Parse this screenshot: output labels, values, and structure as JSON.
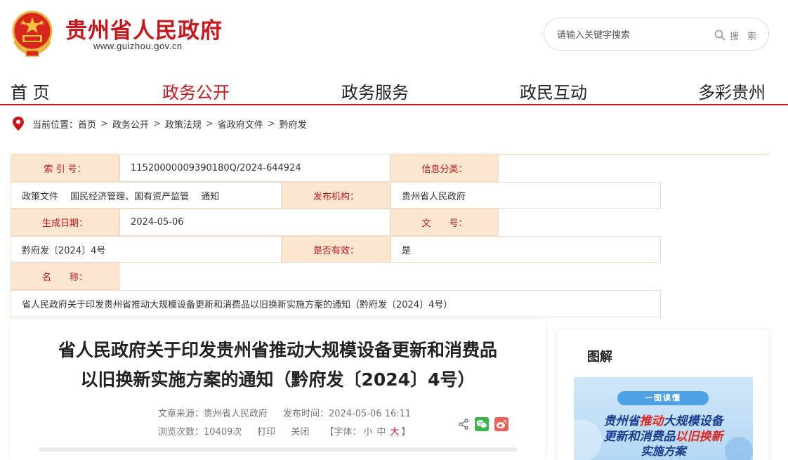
{
  "header": {
    "site_title": "贵州省人民政府",
    "site_url": "www.guizhou.gov.cn",
    "search": {
      "placeholder": "请输入关键字搜索",
      "button_label": "搜 索"
    }
  },
  "nav": {
    "items": [
      {
        "label": "首 页"
      },
      {
        "label": "政务公开"
      },
      {
        "label": "政务服务"
      },
      {
        "label": "政民互动"
      },
      {
        "label": "多彩贵州"
      }
    ],
    "active_index": 1
  },
  "breadcrumb": {
    "prefix": "当前位置：",
    "items": [
      "首页",
      "政务公开",
      "政策法规",
      "省政府文件",
      "黔府发"
    ],
    "separator": ">"
  },
  "info": {
    "index_label": "索 引 号：",
    "index_value": "11520000009390180Q/2024-644924",
    "category_label": "信息分类：",
    "category_value": "政策文件　 国民经济管理、国有资产监管　 通知",
    "publisher_label": "发布机构：",
    "publisher_value": "贵州省人民政府",
    "date_label": "生成日期：",
    "date_value": "2024-05-06",
    "docno_label": "文　　号：",
    "docno_value": "黔府发〔2024〕4号",
    "valid_label": "是否有效：",
    "valid_value": "是",
    "name_label": "名　　称：",
    "name_value": "省人民政府关于印发贵州省推动大规模设备更新和消费品以旧换新实施方案的通知（黔府发〔2024〕4号）"
  },
  "article": {
    "title_line1": "省人民政府关于印发贵州省推动大规模设备更新和消费品",
    "title_line2": "以旧换新实施方案的通知（黔府发〔2024〕4号）",
    "source": "文章来源：贵州省人民政府",
    "publish_time": "发布时间：2024-05-06 16:11",
    "views": "浏览次数：10409次",
    "print_label": "打印",
    "close_label": "关闭",
    "font_label_open": "【字体：",
    "font_sizes": [
      "小",
      "中",
      "大"
    ],
    "font_label_close": "】",
    "active_font_size": "大"
  },
  "sidebar": {
    "title": "图解",
    "promo": {
      "tag": "一图读懂",
      "line1_a": "贵州省",
      "line1_b": "推动",
      "line1_c": "大规模设备",
      "line2_a": "更新和消费品",
      "line2_b": "以旧换新",
      "line3": "实施方案"
    }
  },
  "colors": {
    "brand_red": "#c8161d",
    "label_bg": "#fde6cf",
    "wechat_green": "#3bb54a",
    "weibo_red": "#e8625a"
  }
}
